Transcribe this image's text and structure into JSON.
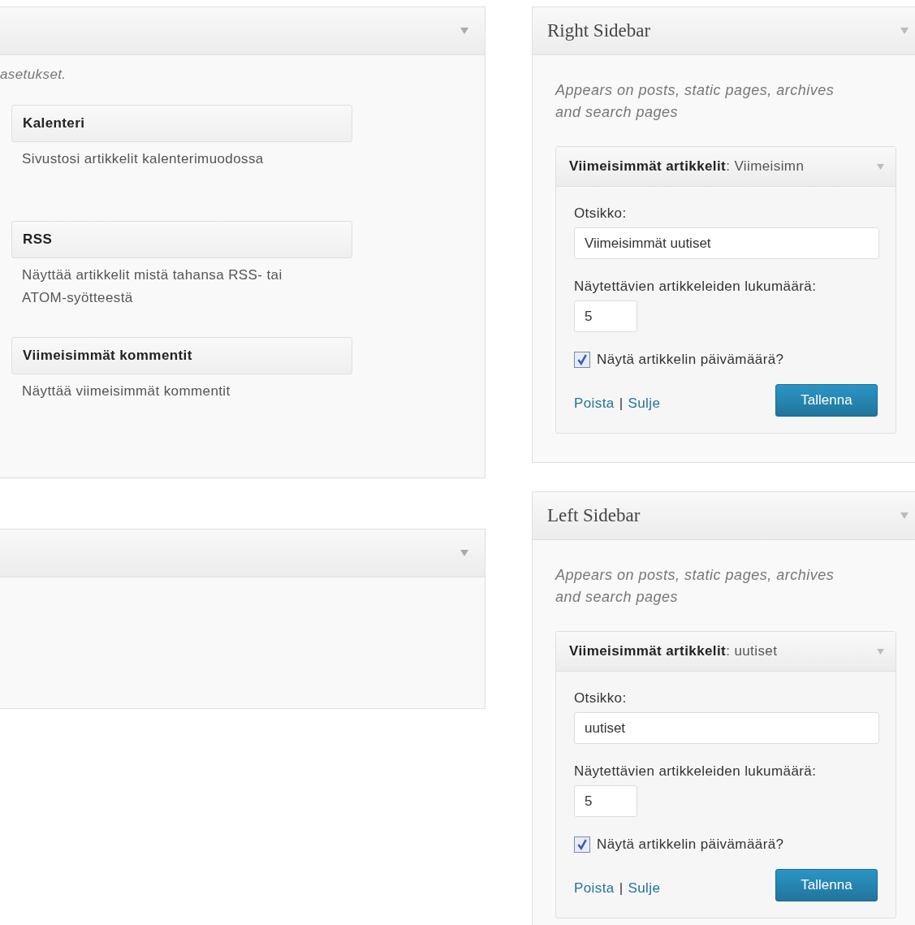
{
  "left_column": [
    {
      "expanded": true,
      "description": "asetukset.",
      "widgets": [
        {
          "title": "Kalenteri",
          "description": "Sivustosi artikkelit kalenterimuodossa"
        },
        {
          "title": "RSS",
          "description": "Näyttää artikkelit mistä tahansa RSS- tai ATOM-syötteestä"
        },
        {
          "title": "Viimeisimmät kommentit",
          "description": "Näyttää viimeisimmät kommentit"
        }
      ]
    },
    {
      "expanded": true
    }
  ],
  "right_column": [
    {
      "title": "Right Sidebar",
      "description": "Appears on posts, static pages, archives and search pages",
      "widgets": [
        {
          "title": "**Viimeisimmät artikkelit**: Viimeisimn",
          "title_label": "Otsikko:",
          "title_value": "Viimeisimmät uutiset",
          "count_label": "Näytettävien artikkeleiden lukumäärä:",
          "count_value": "5",
          "show_date_label": "Näytä artikkelin päivämäärä?",
          "show_date": true,
          "delete_link": "Poista",
          "separator": "|",
          "close_link": "Sulje",
          "save_button": "Tallenna"
        }
      ]
    },
    {
      "title": "Left Sidebar",
      "description": "Appears on posts, static pages, archives and search pages",
      "widgets": [
        {
          "title": "**Viimeisimmät artikkelit**: uutiset",
          "title_label": "Otsikko:",
          "title_value": "uutiset",
          "count_label": "Näytettävien artikkeleiden lukumäärä:",
          "count_value": "5",
          "show_date_label": "Näytä artikkelin päivämäärä?",
          "show_date": true,
          "delete_link": "Poista",
          "separator": "|",
          "close_link": "Sulje",
          "save_button": "Tallenna"
        }
      ]
    }
  ]
}
